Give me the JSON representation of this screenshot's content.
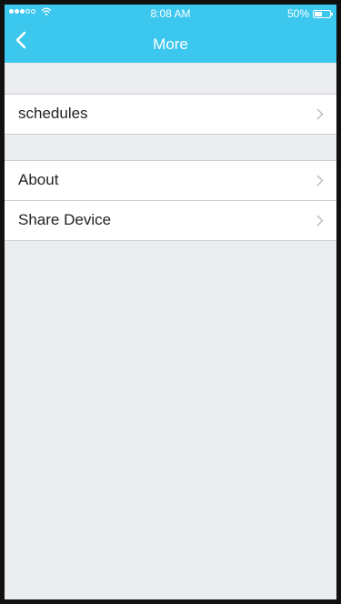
{
  "status_bar": {
    "time": "8:08 AM",
    "battery": "50%",
    "battery_level": 0.5,
    "signal_bars": [
      true,
      true,
      true,
      false,
      false
    ]
  },
  "nav": {
    "title": "More",
    "back_icon": "chevron-left-icon"
  },
  "groups": [
    {
      "items": [
        {
          "label": "schedules"
        }
      ]
    },
    {
      "items": [
        {
          "label": "About"
        },
        {
          "label": "Share Device"
        }
      ]
    }
  ],
  "colors": {
    "header": "#3cc7ef",
    "background": "#ebedf1"
  }
}
